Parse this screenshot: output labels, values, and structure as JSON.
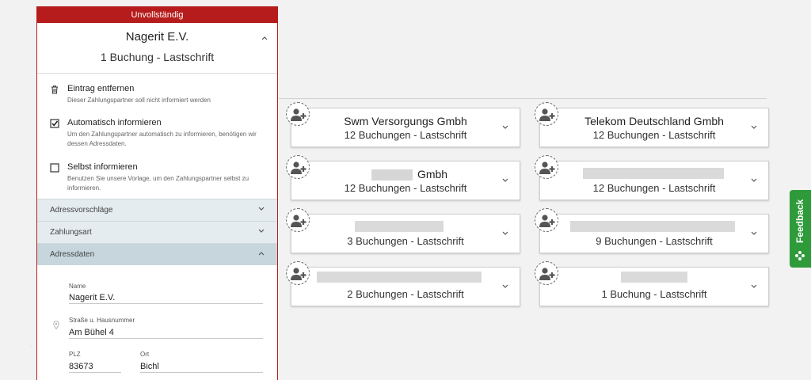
{
  "panel": {
    "status": "Unvollständig",
    "title": "Nagerit E.V.",
    "subtitle": "1 Buchung - Lastschrift",
    "options": [
      {
        "icon": "trash-icon",
        "title": "Eintrag entfernen",
        "desc": "Dieser Zahlungspartner soll nicht informiert werden"
      },
      {
        "icon": "checkbox-checked-icon",
        "title": "Automatisch informieren",
        "desc": "Um den Zahlungspartner automatisch zu informieren, benötigen wir dessen Adressdaten."
      },
      {
        "icon": "checkbox-empty-icon",
        "title": "Selbst informieren",
        "desc": "Benutzen Sie unsere Vorlage, um den Zahlungspartner selbst zu informieren."
      }
    ],
    "sections": [
      "Adressvorschläge",
      "Zahlungsart",
      "Adressdaten"
    ],
    "form": {
      "name_label": "Name",
      "name_value": "Nagerit E.V.",
      "street_label": "Straße u. Hausnummer",
      "street_value": "Am Bühel 4",
      "zip_label": "PLZ",
      "zip_value": "83673",
      "city_label": "Ort",
      "city_value": "Bichl"
    }
  },
  "cards": [
    {
      "title": "Swm Versorgungs Gmbh",
      "subtitle": "12 Buchungen - Lastschrift"
    },
    {
      "title": "Telekom Deutschland Gmbh",
      "subtitle": "12 Buchungen - Lastschrift"
    },
    {
      "title": "Gmbh",
      "subtitle": "12 Buchungen - Lastschrift"
    },
    {
      "title": "",
      "subtitle": "12 Buchungen - Lastschrift"
    },
    {
      "title": "",
      "subtitle": "3 Buchungen - Lastschrift"
    },
    {
      "title": "",
      "subtitle": "9 Buchungen - Lastschrift"
    },
    {
      "title": "",
      "subtitle": "2 Buchungen - Lastschrift"
    },
    {
      "title": "",
      "subtitle": "1 Buchung - Lastschrift"
    }
  ],
  "feedback": {
    "label": "Feedback"
  },
  "colors": {
    "status_red": "#b71c1c",
    "feedback_green": "#2e9a3a",
    "accordion_active": "#c7d6dd"
  }
}
